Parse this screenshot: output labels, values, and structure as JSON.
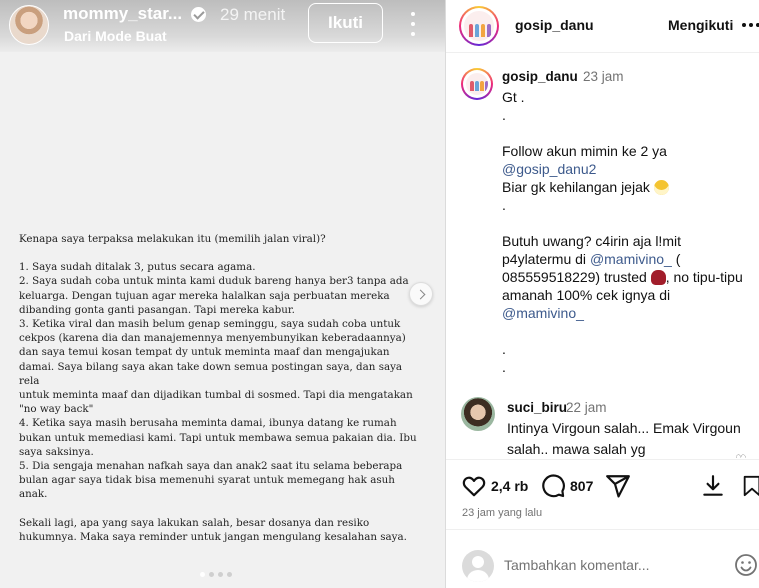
{
  "story": {
    "username": "mommy_star...",
    "time_ago": "29 menit",
    "subtitle": "Dari Mode Buat",
    "follow_label": "Ikuti",
    "text": {
      "title": "Kenapa saya terpaksa melakukan itu (memilih jalan viral)?",
      "points": "1. Saya sudah ditalak 3, putus secara agama.\n2. Saya sudah coba untuk minta kami duduk bareng hanya ber3 tanpa ada\nkeluarga. Dengan tujuan agar mereka halalkan saja perbuatan mereka\ndibanding gonta ganti pasangan. Tapi mereka kabur.\n3. Ketika viral dan masih belum genap seminggu, saya sudah coba untuk\ncekpos (karena dia dan manajemennya menyembunyikan keberadaannya)\ndan saya temui kosan tempat dy untuk meminta maaf dan mengajukan\ndamai. Saya bilang saya akan take down semua postingan saya, dan saya rela\nuntuk meminta maaf dan dijadikan tumbal di sosmed. Tapi dia mengatakan\n\"no way back\"\n4. Ketika saya masih berusaha meminta damai, ibunya datang ke rumah\nbukan untuk memediasi kami. Tapi untuk membawa semua pakaian dia. Ibu\nsaya saksinya.\n5. Dia sengaja menahan nafkah saya dan anak2 saat itu selama beberapa\nbulan agar saya tidak bisa memenuhi syarat untuk memegang hak asuh\nanak.",
      "closing": "Sekali lagi, apa yang saya lakukan salah, besar dosanya dan resiko\nhukumnya. Maka saya reminder untuk jangan mengulang kesalahan saya."
    }
  },
  "post": {
    "header": {
      "username": "gosip_danu",
      "following_label": "Mengikuti"
    },
    "caption": {
      "username": "gosip_danu",
      "time": "23 jam",
      "lines": {
        "l1": "Gt .",
        "l2": ".",
        "l3": "Follow akun mimin ke 2 ya",
        "l4": "@gosip_danu2",
        "l5": "Biar gk kehilangan jejak",
        "l6": ".",
        "l7": "Butuh uwang? c4irin aja l!mit",
        "l8a": "p4ylatermu di ",
        "l8b": "@mamivino_",
        "l8c": " (",
        "l9a": "085559518229) trusted ",
        "l9b": ", no tipu-tipu",
        "l10": "amanah 100% cek ignya di",
        "l11": "@mamivino_",
        "l12": ".",
        "l13": "."
      }
    },
    "comment2": {
      "username": "suci_biru",
      "time": "22 jam",
      "text": "Intinya Virgoun salah... Emak Virgoun salah.. mawa salah yg"
    },
    "likes": "2,4 rb",
    "comments_count": "807",
    "time_ago": "23 jam yang lalu",
    "comment_placeholder": "Tambahkan komentar..."
  },
  "icons": [
    "verified-icon",
    "more-icon",
    "chevron-right-icon",
    "heart-icon",
    "comment-icon",
    "share-icon",
    "download-icon",
    "bookmark-icon",
    "emoji-icon"
  ],
  "colors": {
    "mention": "#3d5a8c",
    "muted": "#737373",
    "divider": "#dbdbdb"
  }
}
